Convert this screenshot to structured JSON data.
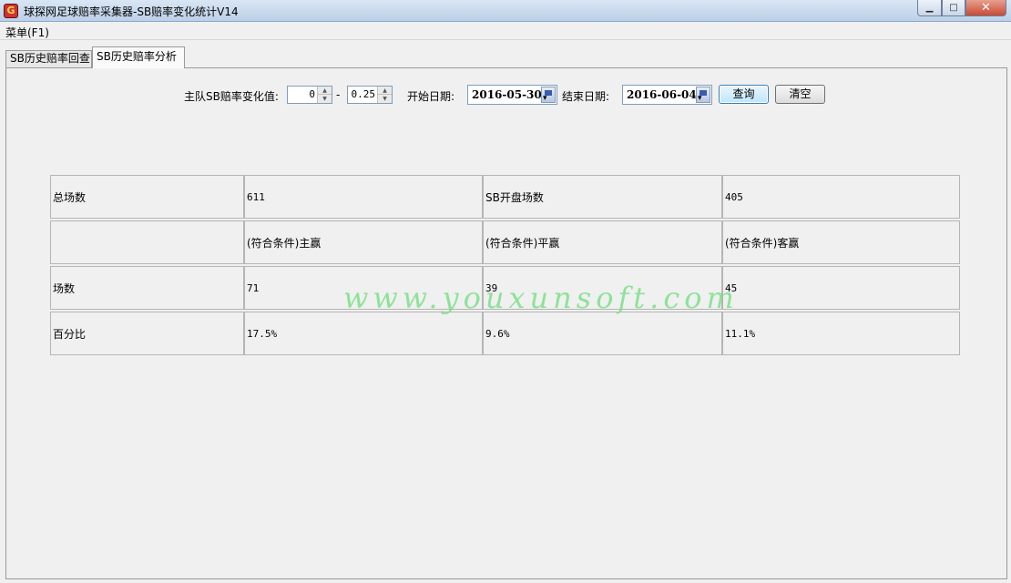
{
  "window": {
    "title": "球探网足球赔率采集器-SB赔率变化统计V14",
    "icon": "app-logo-icon"
  },
  "menu": {
    "items": [
      {
        "label": "菜单(F1)"
      }
    ]
  },
  "tabs": [
    {
      "label": "SB历史赔率回查",
      "active": false
    },
    {
      "label": "SB历史赔率分析",
      "active": true
    }
  ],
  "filters": {
    "change_label": "主队SB赔率变化值:",
    "min_value": "0",
    "separator": "-",
    "max_value": "0.25",
    "start_label": "开始日期:",
    "start_date": "2016-05-30",
    "end_label": "结束日期:",
    "end_date": "2016-06-04",
    "query_button": "查询",
    "clear_button": "清空"
  },
  "stats": {
    "rows": [
      [
        "总场数",
        "611",
        "SB开盘场数",
        "405"
      ],
      [
        "",
        "(符合条件)主赢",
        "(符合条件)平赢",
        "(符合条件)客赢"
      ],
      [
        "场数",
        "71",
        "39",
        "45"
      ],
      [
        "百分比",
        "17.5%",
        "9.6%",
        "11.1%"
      ]
    ]
  },
  "watermark": "www.youxunsoft.com",
  "colors": {
    "accent": "#3c7fb1",
    "watermark": "#7ee08a",
    "close_button": "#c74b34"
  }
}
